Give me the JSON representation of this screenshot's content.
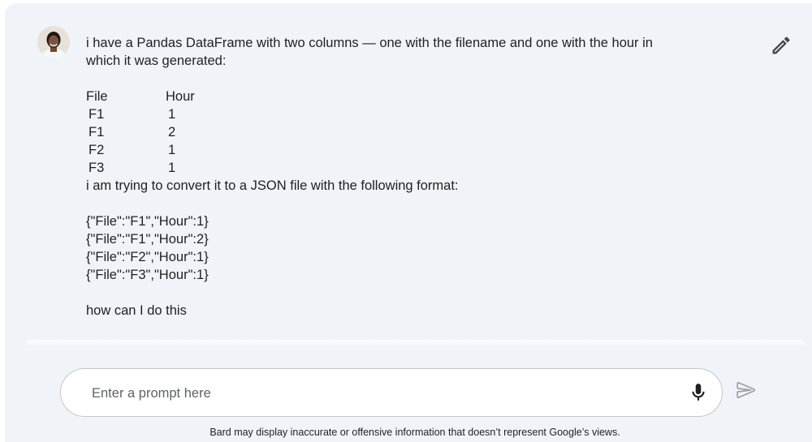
{
  "user": {
    "avatar_icon": "user-avatar-icon"
  },
  "message": {
    "intro_line1": "i have a Pandas DataFrame with two columns — one with the filename and one with the hour in",
    "intro_line2": "which it was generated:",
    "table": {
      "headers": [
        "File",
        "Hour"
      ],
      "rows": [
        [
          "F1",
          "1"
        ],
        [
          "F1",
          "2"
        ],
        [
          "F2",
          "1"
        ],
        [
          "F3",
          "1"
        ]
      ]
    },
    "convert_line": "i am trying to convert it to a JSON file with the following format:",
    "json_lines": [
      "{\"File\":\"F1\",\"Hour\":1}",
      "{\"File\":\"F1\",\"Hour\":2}",
      "{\"File\":\"F2\",\"Hour\":1}",
      "{\"File\":\"F3\",\"Hour\":1}"
    ],
    "question": "how can I do this"
  },
  "actions": {
    "edit_icon": "pencil-icon"
  },
  "prompt": {
    "placeholder": "Enter a prompt here",
    "value": "",
    "mic_icon": "microphone-icon",
    "send_icon": "send-icon"
  },
  "footer": {
    "disclaimer": "Bard may display inaccurate or offensive information that doesn’t represent Google’s views."
  },
  "colors": {
    "page_background": "#f0f4f9",
    "text": "#1f1f1f",
    "placeholder": "#5f6368",
    "icon_dark": "#444746",
    "icon_muted": "#9aa0a6"
  }
}
